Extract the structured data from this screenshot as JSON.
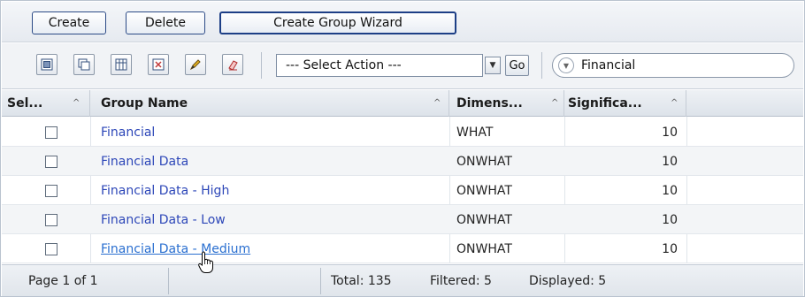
{
  "buttons": {
    "create": "Create",
    "delete": "Delete",
    "wizard": "Create Group Wizard"
  },
  "toolbar": {
    "icons": [
      "select-all-icon",
      "copy-icon",
      "columns-icon",
      "filter-options-icon",
      "edit-pencil-icon",
      "clear-eraser-icon"
    ],
    "action_select": "--- Select Action ---",
    "go": "Go",
    "filter_value": "Financial"
  },
  "columns": [
    {
      "label": "Sel...",
      "sort": "^"
    },
    {
      "label": "Group Name",
      "sort": "^"
    },
    {
      "label": "Dimens...",
      "sort": "^"
    },
    {
      "label": "Significa...",
      "sort": "^"
    }
  ],
  "rows": [
    {
      "name": "Financial",
      "dimension": "WHAT",
      "significance": "10"
    },
    {
      "name": "Financial Data",
      "dimension": "ONWHAT",
      "significance": "10"
    },
    {
      "name": "Financial Data - High",
      "dimension": "ONWHAT",
      "significance": "10"
    },
    {
      "name": "Financial Data - Low",
      "dimension": "ONWHAT",
      "significance": "10"
    },
    {
      "name": "Financial Data - Medium",
      "dimension": "ONWHAT",
      "significance": "10"
    }
  ],
  "footer": {
    "page": "Page 1 of 1",
    "total": "Total: 135",
    "filtered": "Filtered: 5",
    "displayed": "Displayed: 5"
  },
  "colors": {
    "link": "#2d47b8",
    "link_hover": "#2a6fd0",
    "button_border": "#2b4a86"
  }
}
